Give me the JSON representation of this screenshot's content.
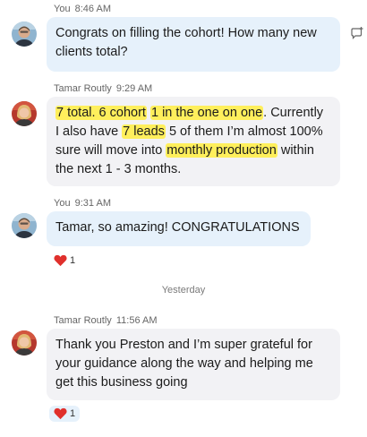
{
  "messages": [
    {
      "sender": "You",
      "time": "8:46 AM",
      "lines": [
        "Congrats on filling the cohort! How many new",
        "clients total?"
      ]
    },
    {
      "sender": "Tamar Routly",
      "time": "9:29 AM",
      "line1": {
        "hl_a": "7 total. 6 cohort",
        "gap_a": " ",
        "hl_b": "1 in the one on one",
        "rest": ". Currently"
      },
      "line2": {
        "pre": "I also have ",
        "hl": "7 leads",
        "rest": " 5 of them I’m almost 100%"
      },
      "line3": {
        "pre": "sure will move into ",
        "hl": "monthly production",
        "rest": " within"
      },
      "line4": "the next 1 - 3 months."
    },
    {
      "sender": "You",
      "time": "9:31 AM",
      "lines": [
        "Tamar, so amazing! CONGRATULATIONS"
      ],
      "reaction_count": "1"
    },
    {
      "sender": "Tamar Routly",
      "time": "11:56 AM",
      "lines": [
        "Thank you Preston and I’m super grateful for",
        "your guidance along the way and helping me",
        "get this business going"
      ],
      "reaction_count": "1"
    }
  ],
  "day_separator": "Yesterday",
  "icons": {
    "react": "add-reaction-icon",
    "reaction": "heart-icon",
    "avatar_you": "avatar-you",
    "avatar_tamar": "avatar-tamar"
  },
  "colors": {
    "my_bubble": "#e6f1fb",
    "their_bubble": "#f2f2f5",
    "highlight": "#ffef5c",
    "heart": "#e0302c"
  }
}
